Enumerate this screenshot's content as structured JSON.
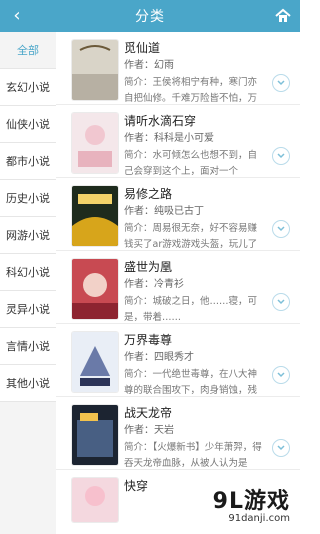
{
  "header": {
    "title": "分类"
  },
  "sidebar": {
    "items": [
      {
        "label": "全部",
        "active": true
      },
      {
        "label": "玄幻小说"
      },
      {
        "label": "仙侠小说"
      },
      {
        "label": "都市小说"
      },
      {
        "label": "历史小说"
      },
      {
        "label": "网游小说"
      },
      {
        "label": "科幻小说"
      },
      {
        "label": "灵异小说"
      },
      {
        "label": "言情小说"
      },
      {
        "label": "其他小说"
      }
    ]
  },
  "books": [
    {
      "title": "觅仙道",
      "author": "作者：幻雨",
      "intro": "简介：王侯将相宁有种，寒门亦自把仙修。千难万险皆不怕，万"
    },
    {
      "title": "请听水滴石穿",
      "author": "作者：科科是小可爱",
      "intro": "简介：水可倾怎么也想不到，自己会穿到这个上，面对一个"
    },
    {
      "title": "易修之路",
      "author": "作者：纯吸已古丁",
      "intro": "简介：周易很无奈，好不容易赚钱买了ar游戏游戏头盔，玩儿了"
    },
    {
      "title": "盛世为凰",
      "author": "作者：冷青衫",
      "intro": "简介：城破之日，他……寝，可是，带着……"
    },
    {
      "title": "万界毒尊",
      "author": "作者：四眼秀才",
      "intro": "简介：一代绝世毒尊，在八大神尊的联合围攻下，肉身销蚀，残"
    },
    {
      "title": "战天龙帝",
      "author": "作者：天岩",
      "intro": "简介：【火爆新书】少年萧羿，得吞天龙帝血脉，从被人认为是"
    },
    {
      "title": "快穿",
      "author": "",
      "intro": ""
    }
  ],
  "watermark": {
    "main": "9L游戏",
    "sub": "91danji.com"
  },
  "colors": {
    "accent": "#4aa6c9",
    "bar": "#4aa6c9"
  }
}
